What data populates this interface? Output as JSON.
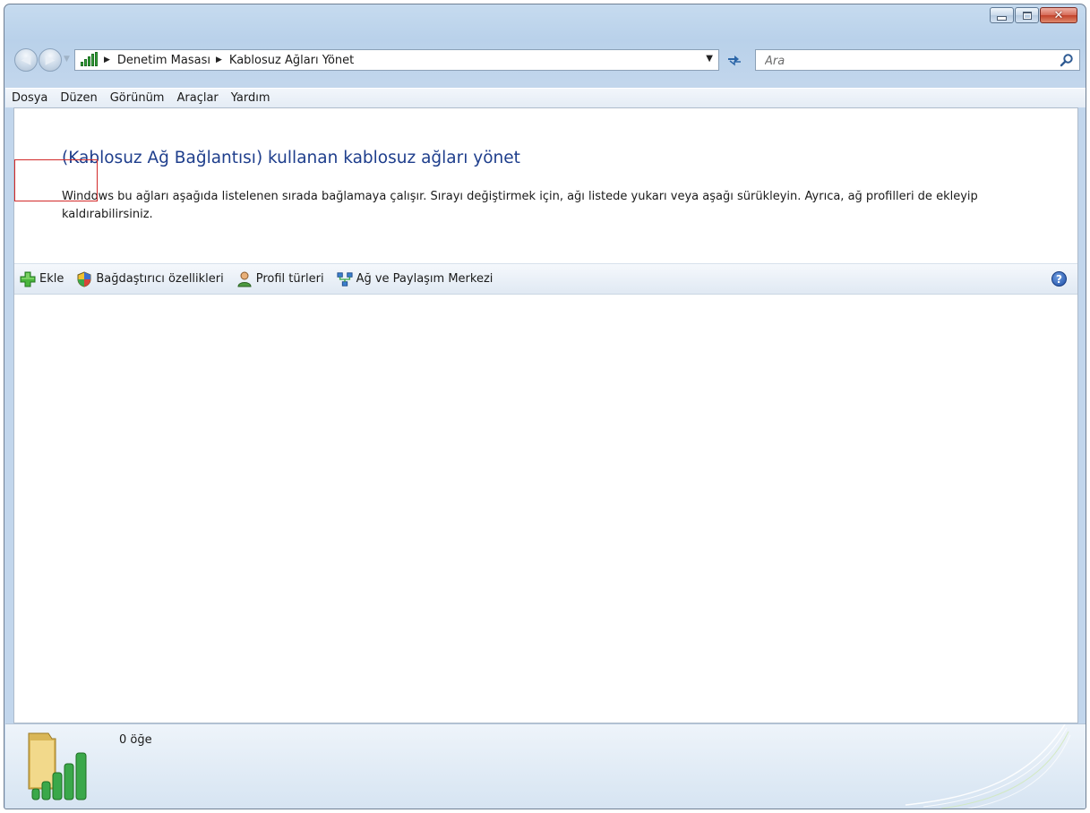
{
  "breadcrumb": {
    "items": [
      "Denetim Masası",
      "Kablosuz Ağları Yönet"
    ]
  },
  "search": {
    "placeholder": "Ara"
  },
  "menu": {
    "items": [
      "Dosya",
      "Düzen",
      "Görünüm",
      "Araçlar",
      "Yardım"
    ]
  },
  "page": {
    "title": "(Kablosuz Ağ Bağlantısı) kullanan kablosuz ağları yönet",
    "description": "Windows bu ağları aşağıda listelenen sırada bağlamaya çalışır. Sırayı değiştirmek için, ağı listede yukarı veya aşağı sürükleyin. Ayrıca, ağ profilleri de ekleyip kaldırabilirsiniz."
  },
  "commands": {
    "add": "Ekle",
    "adapter": "Bağdaştırıcı özellikleri",
    "profile_types": "Profil türleri",
    "network_center": "Ağ ve Paylaşım Merkezi",
    "help": "?"
  },
  "status": {
    "item_count": "0 öğe"
  },
  "colors": {
    "title": "#1e3e8c",
    "highlight": "#d22a2a",
    "signal_green": "#35a53a"
  },
  "icons": {
    "address": "wireless-signal-icon",
    "add": "green-plus-icon",
    "adapter": "shield-icon",
    "profile_types": "user-icon",
    "network_center": "network-icon",
    "help": "help-icon",
    "search": "search-icon",
    "refresh": "refresh-icon"
  }
}
